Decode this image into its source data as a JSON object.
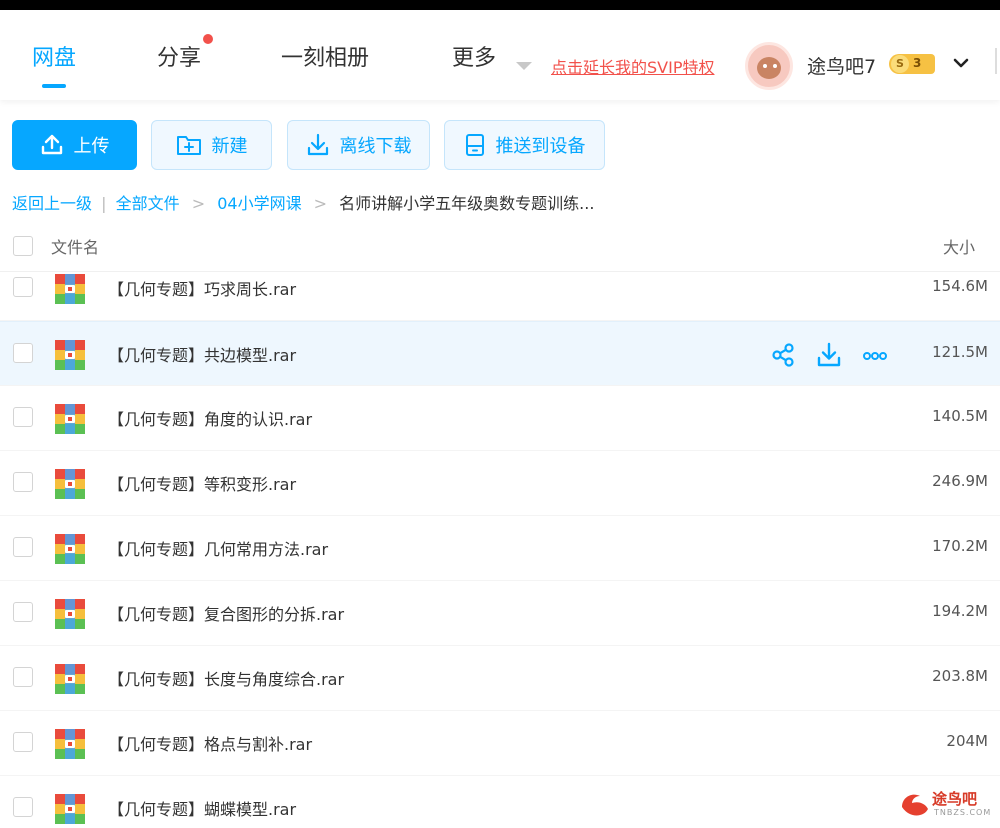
{
  "nav": {
    "tabs": [
      {
        "label": "网盘",
        "active": true
      },
      {
        "label": "分享",
        "has_notification_dot": true
      },
      {
        "label": "一刻相册"
      },
      {
        "label": "更多"
      }
    ],
    "svip_link": "点击延长我的SVIP特权",
    "username": "途鸟吧7",
    "coin_badge": {
      "symbol": "S",
      "level": "3"
    }
  },
  "toolbar": {
    "upload": "上传",
    "new": "新建",
    "offline_download": "离线下载",
    "push_to_device": "推送到设备"
  },
  "breadcrumb": {
    "back": "返回上一级",
    "separator": "|",
    "items": [
      "全部文件",
      "04小学网课"
    ],
    "current": "名师讲解小学五年级奥数专题训练..."
  },
  "list_header": {
    "name": "文件名",
    "size": "大小"
  },
  "files": [
    {
      "name": "【几何专题】巧求周长.rar",
      "size": "154.6M"
    },
    {
      "name": "【几何专题】共边模型.rar",
      "size": "121.5M",
      "hovered": true
    },
    {
      "name": "【几何专题】角度的认识.rar",
      "size": "140.5M"
    },
    {
      "name": "【几何专题】等积变形.rar",
      "size": "246.9M"
    },
    {
      "name": "【几何专题】几何常用方法.rar",
      "size": "170.2M"
    },
    {
      "name": "【几何专题】复合图形的分拆.rar",
      "size": "194.2M"
    },
    {
      "name": "【几何专题】长度与角度综合.rar",
      "size": "203.8M"
    },
    {
      "name": "【几何专题】格点与割补.rar",
      "size": "204M"
    },
    {
      "name": "【几何专题】蝴蝶模型.rar",
      "size": ""
    }
  ],
  "row_actions": [
    "share-icon",
    "download-icon",
    "more-icon"
  ],
  "watermark": {
    "text": "途鸟吧",
    "sub": "TNBZS.COM"
  },
  "colors": {
    "accent": "#06a7ff",
    "danger": "#f2514b",
    "hover_row": "#eef7fe"
  }
}
